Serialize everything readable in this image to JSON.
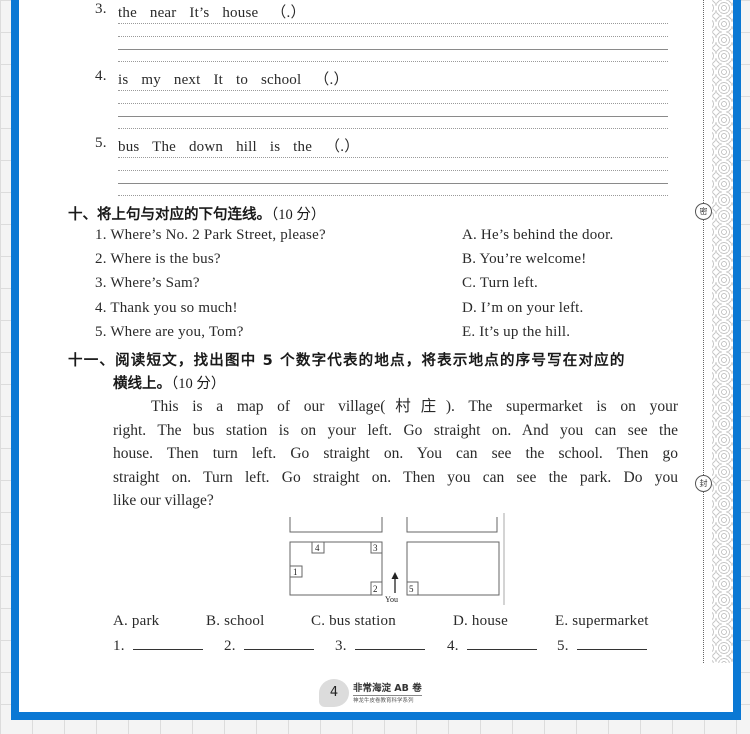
{
  "reorder_section": {
    "items": [
      {
        "num": "3.",
        "words": "the near It’s house （.）"
      },
      {
        "num": "4.",
        "words": "is my next It to school （.）"
      },
      {
        "num": "5.",
        "words": "bus The down hill is the （.）"
      }
    ]
  },
  "section10": {
    "title": "十、将上句与对应的下句连线。",
    "score": "（10 分）",
    "left_items": [
      "1. Where’s No. 2 Park Street, please?",
      "2. Where is the bus?",
      "3. Where’s Sam?",
      "4. Thank you so much!",
      "5. Where are you, Tom?"
    ],
    "right_items": [
      "A. He’s behind the door.",
      "B. You’re welcome!",
      "C. Turn left.",
      "D. I’m on your left.",
      "E. It’s up the hill."
    ]
  },
  "section11": {
    "title_line1": "十一、阅读短文，找出图中 5 个数字代表的地点，将表示地点的序号写在对应的",
    "title_line2": "横线上。",
    "score": "（10 分）",
    "passage_lines": [
      "This is a map of our village(村庄). The supermarket is on your",
      "right. The bus station is on your left. Go straight on. And you can see the",
      "house. Then turn left. Go straight on. You can see the school. Then go",
      "straight on. Turn left. Go straight on. Then you can see the park. Do you",
      "like our village?"
    ],
    "map": {
      "labels": [
        "1",
        "2",
        "3",
        "4",
        "5"
      ],
      "you_label": "You"
    },
    "options": [
      "A. park",
      "B. school",
      "C. bus station",
      "D. house",
      "E. supermarket"
    ],
    "answers": [
      "1.",
      "2.",
      "3.",
      "4.",
      "5."
    ]
  },
  "seal_marks": [
    "密",
    "封"
  ],
  "footer": {
    "page_number": "4",
    "book_title": "非常海淀 AB 卷",
    "series": "神龙牛皮卷教育科学系列"
  }
}
